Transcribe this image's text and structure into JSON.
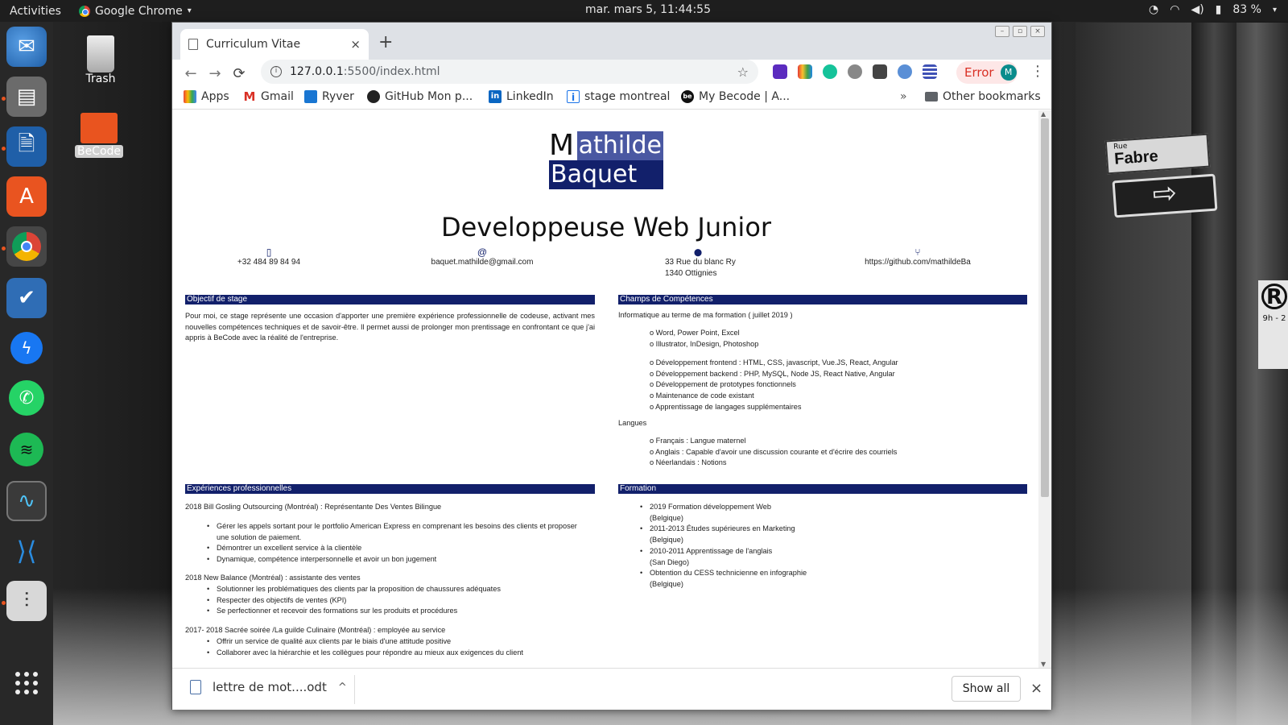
{
  "topbar": {
    "activities": "Activities",
    "app": "Google Chrome",
    "app_caret": "▾",
    "clock": "mar. mars  5, 11:44:55",
    "battery": "83 %",
    "status_caret": "▾"
  },
  "desktop": {
    "trash_label": "Trash",
    "folder_label": "BeCode"
  },
  "street": {
    "rue": "Rue",
    "name": "Fabre",
    "parking_symbol": "R",
    "parking_hours": "9h - 2"
  },
  "browser": {
    "tab_title": "Curriculum Vitae",
    "tab_close": "×",
    "new_tab": "+",
    "win_controls": [
      "–",
      "▫",
      "×"
    ],
    "nav": {
      "back": "←",
      "forward": "→",
      "reload": "⟳"
    },
    "url_host": "127.0.0.1",
    "url_path": ":5500/index.html",
    "url_info_icon": "i",
    "star": "☆",
    "error_label": "Error",
    "avatar_letter": "M",
    "menu": "⋮",
    "bookmarks": [
      {
        "label": "Apps"
      },
      {
        "label": "Gmail"
      },
      {
        "label": "Ryver"
      },
      {
        "label": "GitHub Mon p..."
      },
      {
        "label": "LinkedIn"
      },
      {
        "label": "stage montreal"
      },
      {
        "label": "My Becode | A..."
      }
    ],
    "bookmarks_overflow": "»",
    "other_bookmarks": "Other bookmarks"
  },
  "cv": {
    "logo_m": "M",
    "logo_athilde": "athilde",
    "logo_baquet": "Baquet",
    "title": "Developpeuse Web Junior",
    "contacts": {
      "phone": "+32 484 89 84 94",
      "email": "baquet.mathilde@gmail.com",
      "address_1": "33 Rue du blanc Ry",
      "address_2": "1340 Ottignies",
      "github": "https://github.com/mathildeBa"
    },
    "contact_icons": {
      "phone": "▯",
      "email": "@",
      "address": "⬤",
      "github": "⑂"
    },
    "sections": {
      "objectif": "Objectif de stage",
      "competences": "Champs de Compétences",
      "experiences": "Expériences professionnelles",
      "formation": "Formation"
    },
    "objectif_text": "Pour moi, ce stage représente une occasion d'apporter une première expérience professionnelle de codeuse, activant mes nouvelles compétences techniques et de savoir-être. Il permet aussi de prolonger mon prentissage en confrontant ce que j'ai appris à BeCode avec la réalité de l'entreprise.",
    "competences_intro": "Informatique au terme de ma formation ( juillet 2019 )",
    "competences_group1": [
      "o Word, Power Point, Excel",
      "o Illustrator, InDesign, Photoshop"
    ],
    "competences_group2": [
      "o Développement frontend : HTML, CSS, javascript, Vue.JS, React, Angular",
      "o Développement backend : PHP, MySQL, Node JS, React Native, Angular",
      "o Développement de prototypes fonctionnels",
      "o Maintenance de code existant",
      "o Apprentissage de langages supplémentaires"
    ],
    "langues_label": "Langues",
    "langues": [
      "o Français : Langue maternel",
      "o Anglais : Capable d'avoir une discussion courante et d'écrire des courriels",
      "o Néerlandais : Notions"
    ],
    "experiences": [
      {
        "title": "2018 Bill Gosling Outsourcing (Montréal) : Représentante Des Ventes Bilingue",
        "items": [
          "Gérer les appels sortant pour le portfolio American Express en comprenant les besoins des clients et proposer une solution de paiement.",
          "Démontrer un excellent service à la clientèle",
          "Dynamique, compétence interpersonnelle et avoir un bon jugement"
        ]
      },
      {
        "title": "2018 New Balance (Montréal) : assistante des ventes",
        "items": [
          "Solutionner les problématiques des clients par la proposition de chaussures adéquates",
          "Respecter des objectifs de ventes (KPI)",
          "Se perfectionner et recevoir des formations sur les produits et procédures"
        ]
      },
      {
        "title": "2017- 2018 Sacrée soirée /La guilde Culinaire (Montréal) : employée au service",
        "items": [
          "Offrir un service de qualité aux clients par le biais d'une attitude positive",
          "Collaborer avec la hiérarchie et les collègues pour répondre au mieux aux exigences du client"
        ]
      }
    ],
    "formation": [
      {
        "line1": "2019 Formation développement Web",
        "line2": "(Belgique)"
      },
      {
        "line1": "2011-2013 Études supérieures en Marketing",
        "line2": "(Belgique)"
      },
      {
        "line1": "2010-2011 Apprentissage de l'anglais",
        "line2": "(San Diego)"
      },
      {
        "line1": "Obtention du CESS technicienne en infographie",
        "line2": "(Belgique)"
      }
    ]
  },
  "download": {
    "filename": "lettre de mot....odt",
    "caret": "^",
    "show_all": "Show all",
    "close": "×"
  },
  "colors": {
    "accent_dark": "#12206b",
    "accent_light": "#4a58a2",
    "error_red": "#d93025",
    "ubuntu_orange": "#e95420"
  }
}
